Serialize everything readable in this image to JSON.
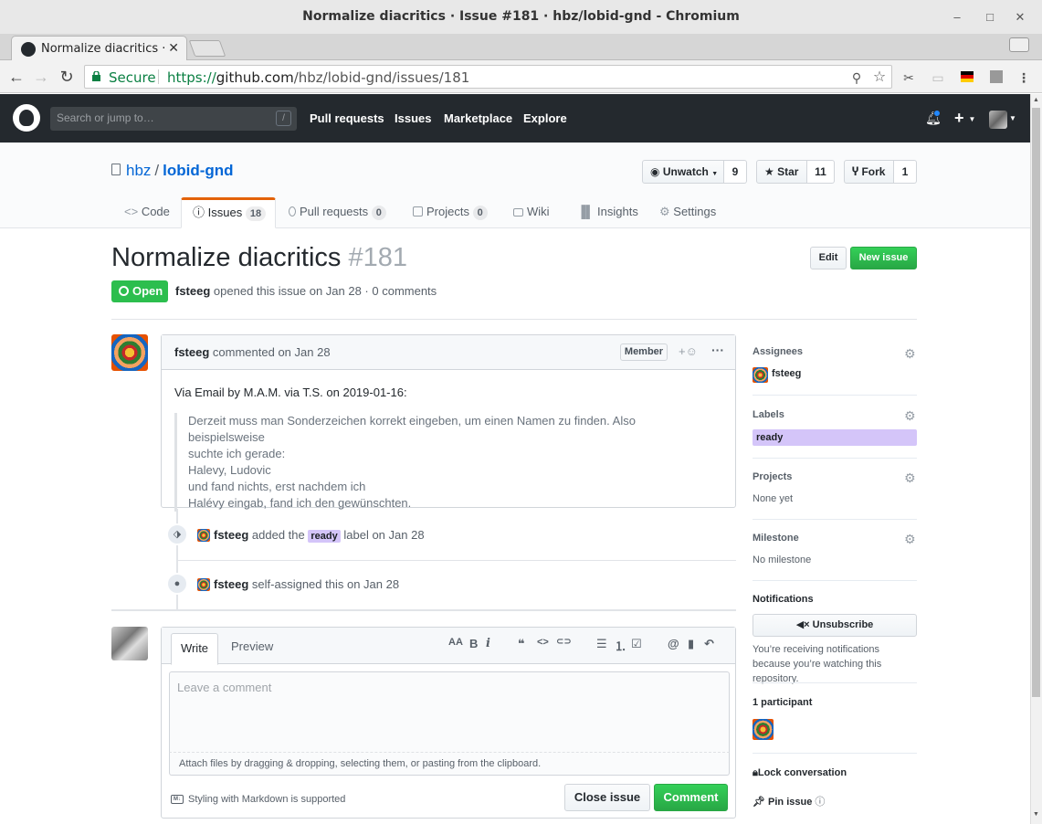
{
  "window": {
    "title": "Normalize diacritics · Issue #181 · hbz/lobid-gnd - Chromium",
    "tab_title": "Normalize diacritics · Issue",
    "controls": {
      "minimize": "–",
      "maximize": "□",
      "close": "✕"
    }
  },
  "omnibox": {
    "secure_label": "Secure",
    "url_scheme": "https://",
    "url_host": "github.com",
    "url_path": "/hbz/lobid-gnd/issues/181"
  },
  "gh_header": {
    "search_placeholder": "Search or jump to…",
    "search_shortcut": "/",
    "nav": [
      "Pull requests",
      "Issues",
      "Marketplace",
      "Explore"
    ],
    "plus": "+"
  },
  "repo": {
    "owner": "hbz",
    "separator": "/",
    "name": "lobid-gnd",
    "unwatch_label": "Unwatch",
    "watch_count": "9",
    "star_label": "Star",
    "star_count": "11",
    "fork_label": "Fork",
    "fork_count": "1",
    "tabs": [
      {
        "label": "Code",
        "icon": "code-icon"
      },
      {
        "label": "Issues",
        "icon": "issue-opened-icon",
        "count": "18"
      },
      {
        "label": "Pull requests",
        "icon": "git-pull-request-icon",
        "count": "0"
      },
      {
        "label": "Projects",
        "icon": "project-icon",
        "count": "0"
      },
      {
        "label": "Wiki",
        "icon": "book-icon"
      },
      {
        "label": "Insights",
        "icon": "graph-icon"
      },
      {
        "label": "Settings",
        "icon": "gear-icon"
      }
    ]
  },
  "issue": {
    "title": "Normalize diacritics",
    "number": "#181",
    "edit_label": "Edit",
    "new_issue_label": "New issue",
    "state": "Open",
    "author": "fsteeg",
    "meta": "opened this issue on Jan 28 · 0 comments"
  },
  "comment": {
    "author": "fsteeg",
    "action": "commented on Jan 28",
    "role": "Member",
    "body_intro": "Via Email by M.A.M. via T.S. on 2019-01-16:",
    "quote": [
      "Derzeit muss man Sonderzeichen korrekt eingeben, um einen Namen zu finden. Also beispielsweise",
      "suchte ich gerade:",
      "Halevy, Ludovic",
      "und fand nichts, erst nachdem ich",
      "Halévy eingab, fand ich den gewünschten."
    ]
  },
  "timeline": [
    {
      "actor": "fsteeg",
      "before": "added the",
      "label": "ready",
      "after": "label on Jan 28",
      "icon": "tag-icon"
    },
    {
      "actor": "fsteeg",
      "text": "self-assigned this on Jan 28",
      "icon": "person-icon"
    }
  ],
  "new_comment": {
    "write_tab": "Write",
    "preview_tab": "Preview",
    "placeholder": "Leave a comment",
    "attach_note": "Attach files by dragging & dropping, selecting them, or pasting from the clipboard.",
    "markdown_note": "Styling with Markdown is supported",
    "close_label": "Close issue",
    "comment_label": "Comment",
    "toolbar": {
      "header": "AA",
      "bold": "B",
      "italic": "i",
      "quote": "❝",
      "code": "<>",
      "link": "⊂⊃",
      "ul": "☰",
      "ol": "⒈",
      "task": "☑",
      "mention": "@",
      "bookmark": "▮",
      "reply": "↶"
    }
  },
  "sidebar": {
    "assignees_label": "Assignees",
    "assignee": "fsteeg",
    "labels_label": "Labels",
    "label": "ready",
    "projects_label": "Projects",
    "projects_value": "None yet",
    "milestone_label": "Milestone",
    "milestone_value": "No milestone",
    "notifications_label": "Notifications",
    "unsubscribe_label": "Unsubscribe",
    "notif_note": "You’re receiving notifications because you’re watching this repository.",
    "participants_label": "1 participant",
    "lock_label": "Lock conversation",
    "pin_label": "Pin issue"
  },
  "colors": {
    "header_bg": "#24292e",
    "open_green": "#2cbe4e",
    "link_blue": "#0366d6",
    "tab_accent": "#e36209",
    "ready_label": "#d4c5f9"
  }
}
